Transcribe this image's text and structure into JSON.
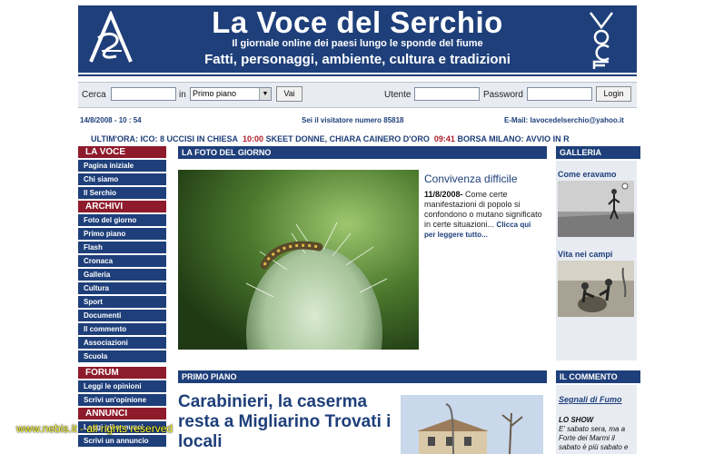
{
  "header": {
    "title": "La Voce del Serchio",
    "subtitle": "Il giornale online dei paesi lungo le sponde del fiume",
    "tagline": "Fatti, personaggi, ambiente, cultura e tradizioni",
    "bg_color": "#1e3f7a"
  },
  "toolbar": {
    "search_label": "Cerca",
    "search_value": "",
    "in_label": "in",
    "section_selected": "Primo piano",
    "go_label": "Vai",
    "user_label": "Utente",
    "user_value": "",
    "password_label": "Password",
    "password_value": "",
    "login_label": "Login"
  },
  "infobar": {
    "datetime": "14/8/2008 - 10 : 54",
    "visitor_text": "Sei il visitatore numero 85818",
    "email_text": "E-Mail: lavocedelserchio@yahoo.it"
  },
  "ticker": {
    "label": "ULTIM'ORA:",
    "item1_text": "ICO: 8 UCCISI IN CHIESA",
    "item2_time": "10:00",
    "item2_text": "SKEET DONNE, CHIARA CAINERO D'ORO",
    "item3_time": "09:41",
    "item3_text": "BORSA MILANO: AVVIO IN R"
  },
  "sidebar": {
    "la_voce": "LA VOCE",
    "items_voce": [
      "Pagina iniziale",
      "Chi siamo",
      "Il Serchio"
    ],
    "archivi": "ARCHIVI",
    "items_archivi": [
      "Foto del giorno",
      "Primo piano",
      "Flash",
      "Cronaca",
      "Galleria",
      "Cultura",
      "Sport",
      "Documenti",
      "Il commento",
      "Associazioni",
      "Scuola"
    ],
    "forum": "FORUM",
    "items_forum": [
      "Leggi le opinioni",
      "Scrivi un'opinione"
    ],
    "annunci": "ANNUNCI",
    "items_annunci": [
      "Leggi gli annunci",
      "Scrivi un annuncio"
    ],
    "section_color": "#8e1b2c"
  },
  "foto": {
    "head": "LA FOTO DEL GIORNO",
    "title": "Convivenza difficile",
    "date": "11/8/2008-",
    "text": " Come certe manifestazioni di popolo si confondono o mutano significato in certe situazioni... ",
    "more": "Clicca qui per leggere tutto..."
  },
  "galleria": {
    "head": "GALLERIA",
    "item1": "Come eravamo",
    "item2": "Vita nei campi"
  },
  "primo": {
    "head": "PRIMO PIANO",
    "title": "Carabinieri, la caserma resta a Migliarino Trovati i locali"
  },
  "commento": {
    "head": "IL COMMENTO",
    "link": "Segnali di Fumo",
    "sub": "LO SHOW",
    "text": "E' sabato sera, ma a Forte dei Marmi il sabato è più sabato e"
  },
  "watermark": "www.nebis.it - all rights reserved"
}
